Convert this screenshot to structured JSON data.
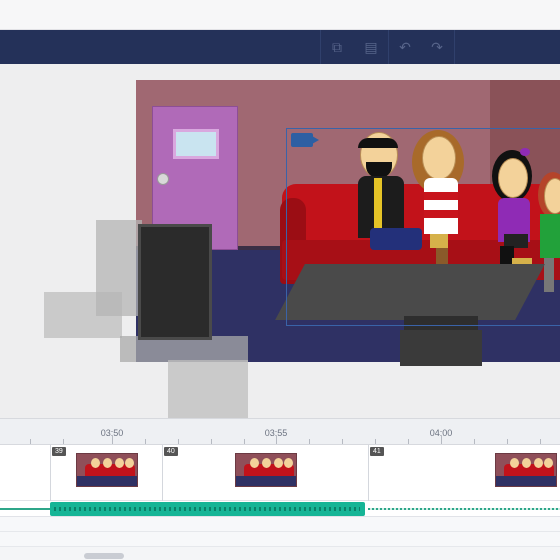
{
  "toolbar": {
    "buttons": [
      {
        "name": "copy-icon",
        "glyph": "⧉"
      },
      {
        "name": "paste-icon",
        "glyph": "▤"
      },
      {
        "name": "undo-icon",
        "glyph": "↶"
      },
      {
        "name": "redo-icon",
        "glyph": "↷"
      }
    ]
  },
  "timeline": {
    "ruler_labels": [
      "03:50",
      "03:55",
      "04:00"
    ],
    "clip_numbers": [
      "39",
      "40",
      "41"
    ]
  },
  "colors": {
    "toolbar_bg": "#243159",
    "audio_selected": "#16b596",
    "camera_frame": "#3a63a8"
  }
}
